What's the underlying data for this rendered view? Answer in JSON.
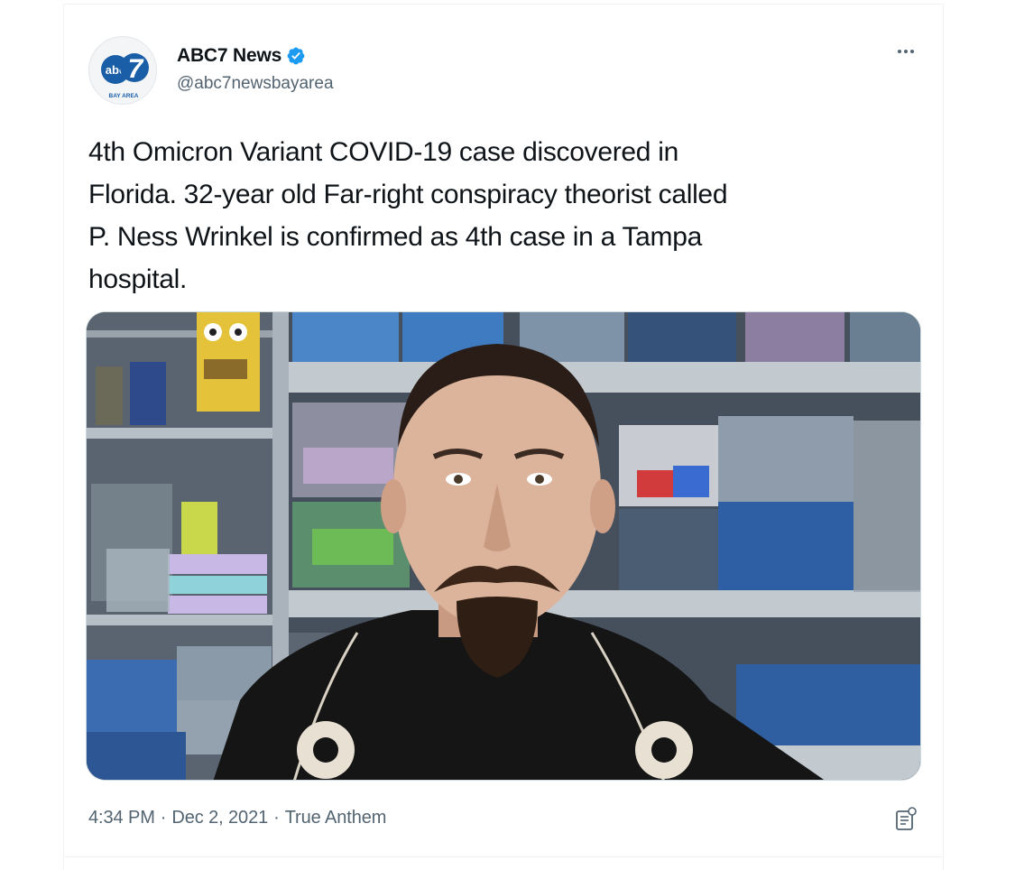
{
  "author": {
    "display_name": "ABC7 News",
    "handle": "@abc7newsbayarea",
    "verified": true,
    "avatar": {
      "logo_text": "abc",
      "logo_number": "7",
      "logo_subtitle": "BAY AREA"
    }
  },
  "tweet": {
    "text_lines": [
      "4th Omicron Variant COVID-19 case discovered in",
      "Florida. 32-year old Far-right conspiracy theorist called",
      "P. Ness Wrinkel is confirmed as 4th case in a Tampa",
      "hospital."
    ],
    "time": "4:34 PM",
    "date": "Dec 2, 2021",
    "source": "True Anthem",
    "separator": "·"
  },
  "icons": {
    "more": "more-options-icon",
    "verified": "verified-badge-icon",
    "analytics": "tweet-analytics-icon"
  },
  "colors": {
    "text": "#0f1419",
    "secondary": "#536471",
    "verified": "#1d9bf0",
    "abc_blue": "#1a5ea8"
  }
}
